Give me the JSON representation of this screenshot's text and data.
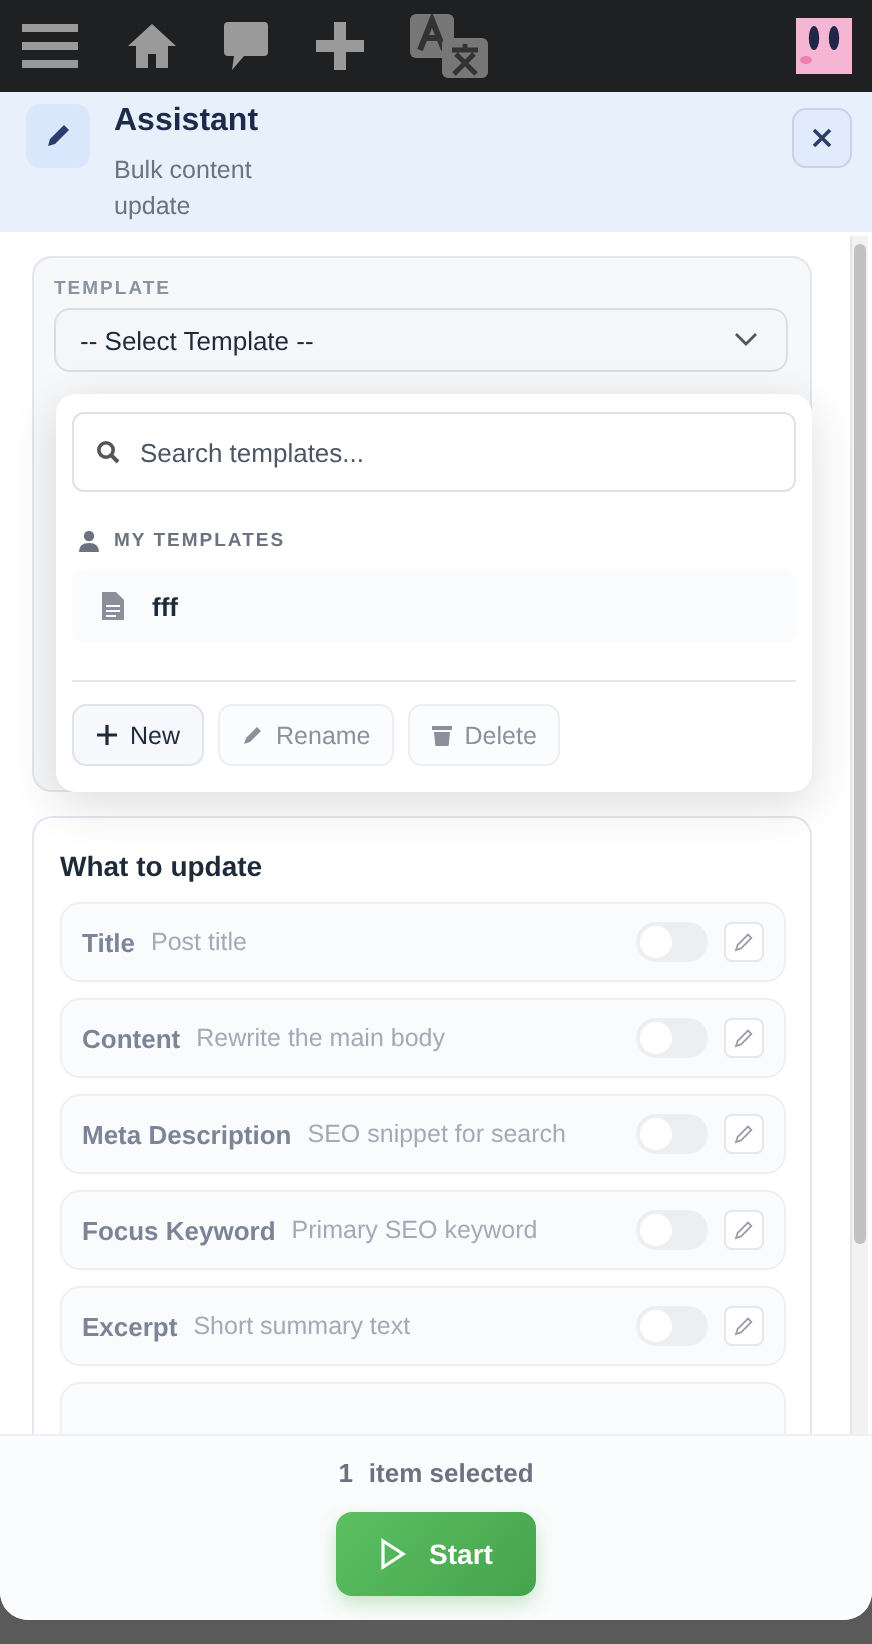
{
  "header": {
    "title": "Assistant",
    "subtitle": "Bulk content update"
  },
  "template": {
    "label": "TEMPLATE",
    "select_value": "-- Select Template --",
    "search": {
      "placeholder": "Search templates..."
    },
    "group": "MY TEMPLATES",
    "items": [
      {
        "name": "fff",
        "selected": false
      }
    ],
    "actions": [
      {
        "label": "New",
        "kind": "add",
        "disabled": false
      },
      {
        "label": "Rename",
        "kind": "rename",
        "disabled": true
      },
      {
        "label": "Delete",
        "kind": "delete",
        "disabled": true
      }
    ]
  },
  "fields": {
    "title": "What to update",
    "rows": [
      {
        "name": "Title",
        "hint": "Post title",
        "on": false
      },
      {
        "name": "Content",
        "hint": "Rewrite the main body",
        "on": false
      },
      {
        "name": "Meta Description",
        "hint": "SEO snippet for search",
        "on": false
      },
      {
        "name": "Focus Keyword",
        "hint": "Primary SEO keyword",
        "on": false
      },
      {
        "name": "Excerpt",
        "hint": "Short summary text",
        "on": false
      }
    ]
  },
  "footer": {
    "count": "1",
    "count_label": "item selected",
    "start": "Start"
  }
}
